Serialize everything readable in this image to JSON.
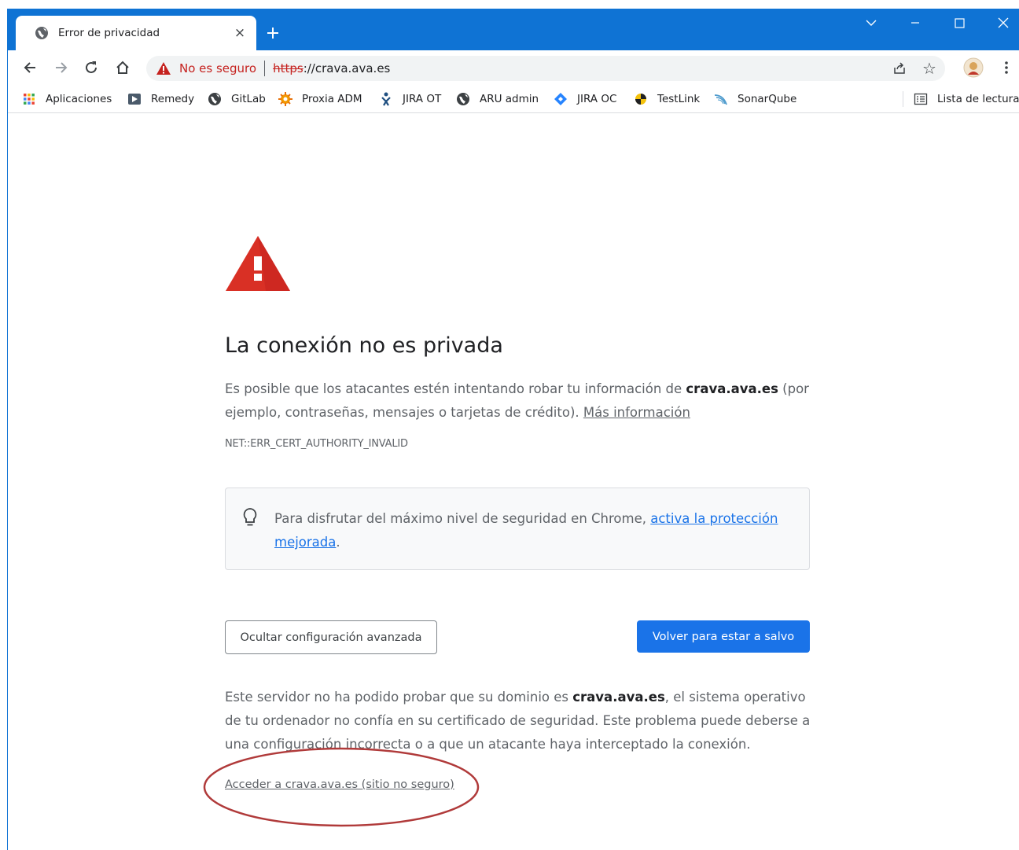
{
  "browser": {
    "tab": {
      "title": "Error de privacidad",
      "close": "×"
    },
    "new_tab": "+",
    "omnibox": {
      "security_status": "No es seguro",
      "scheme": "https",
      "host_suffix": "://crava.ava.es"
    },
    "bookmarks": [
      {
        "label": "Aplicaciones",
        "icon": "apps-grid-icon"
      },
      {
        "label": "Remedy",
        "icon": "remedy-icon"
      },
      {
        "label": "GitLab",
        "icon": "globe-icon"
      },
      {
        "label": "Proxia ADM",
        "icon": "proxia-icon"
      },
      {
        "label": "JIRA OT",
        "icon": "jira-icon"
      },
      {
        "label": "ARU admin",
        "icon": "globe-icon"
      },
      {
        "label": "JIRA OC",
        "icon": "jira-diamond-icon"
      },
      {
        "label": "TestLink",
        "icon": "testlink-icon"
      },
      {
        "label": "SonarQube",
        "icon": "sonarqube-icon"
      }
    ],
    "reading_list": "Lista de lectura",
    "colors": {
      "frame": "#0f73d4",
      "insecure": "#c5221f"
    }
  },
  "interstitial": {
    "heading": "La conexión no es privada",
    "explanation": {
      "pre": "Es posible que los atacantes estén intentando robar tu información de ",
      "domain": "crava.ava.es",
      "post": " (por ejemplo, contraseñas, mensajes o tarjetas de crédito). ",
      "more_link": "Más información"
    },
    "error_code": "NET::ERR_CERT_AUTHORITY_INVALID",
    "tip": {
      "text": "Para disfrutar del máximo nivel de seguridad en Chrome, ",
      "link": "activa la protección mejorada",
      "end": "."
    },
    "hide_advanced_button": "Ocultar configuración avanzada",
    "back_to_safety_button": "Volver para estar a salvo",
    "details": {
      "pre": "Este servidor no ha podido probar que su dominio es ",
      "domain": "crava.ava.es",
      "post": ", el sistema operativo de tu ordenador no confía en su certificado de seguridad. Este problema puede deberse a una configuración incorrecta o a que un atacante haya interceptado la conexión."
    },
    "proceed_link": "Acceder a crava.ava.es (sitio no seguro)",
    "colors": {
      "primary": "#1a73e8",
      "warning": "#d93025",
      "annotation": "#b03a3a"
    }
  }
}
